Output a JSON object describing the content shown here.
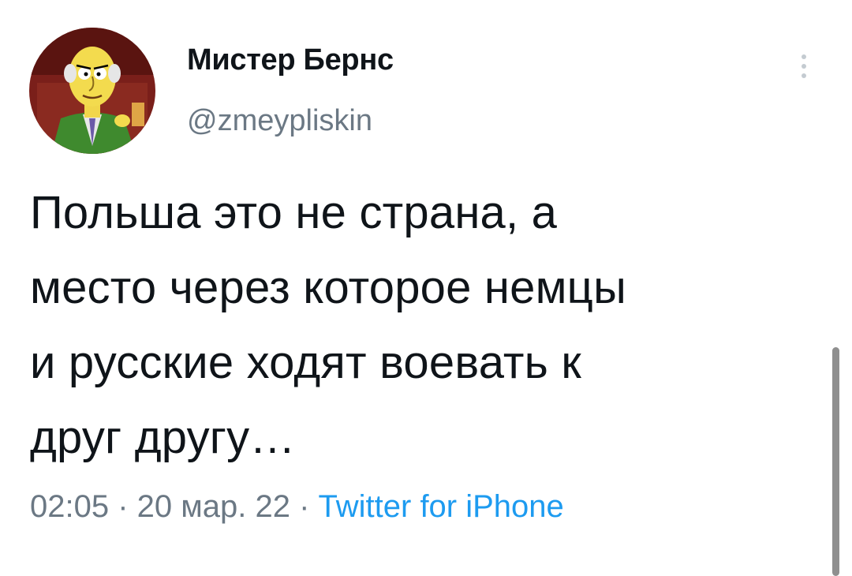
{
  "tweet": {
    "author": {
      "display_name": "Мистер Бернс",
      "handle": "@zmeypliskin",
      "avatar_icon": "mr-burns-avatar"
    },
    "text_lines": [
      "Польша это не страна, а",
      "место через которое немцы",
      "и русские ходят воевать к",
      "друг другу…"
    ],
    "time": "02:05",
    "separator": " · ",
    "date": "20 мар. 22",
    "source": "Twitter for iPhone",
    "more_icon": "more-vertical-icon"
  },
  "colors": {
    "text": "#0f1419",
    "secondary": "#6b7884",
    "link": "#1d9bf0"
  }
}
